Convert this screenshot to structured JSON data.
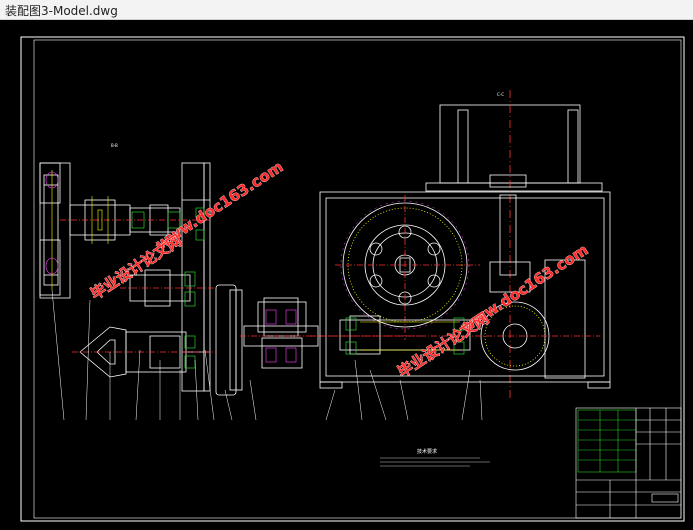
{
  "window": {
    "title": "装配图3-Model.dwg"
  },
  "drawing": {
    "view_labels": {
      "left_section": "B-B",
      "right_section": "C-C",
      "circle_label": "A"
    },
    "notes_title": "技术要求",
    "colors": {
      "outline": "#ffffff",
      "centerline": "#ff3030",
      "green": "#2bd12b",
      "yellow": "#ffff00",
      "cyan": "#00ffff",
      "magenta": "#ff40ff",
      "blue": "#3b6bff",
      "watermark": "#ff2a2a"
    }
  },
  "watermarks": {
    "url_text": "www.doc163.com",
    "cn_text": "毕业设计论文网"
  }
}
